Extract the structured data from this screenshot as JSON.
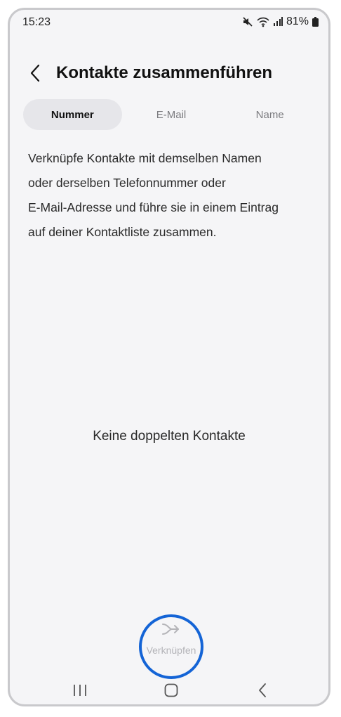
{
  "status_bar": {
    "time": "15:23",
    "battery": "81%",
    "icons": [
      "mute-icon",
      "wifi-icon",
      "signal-icon",
      "battery-icon"
    ]
  },
  "header": {
    "title": "Kontakte zusammenführen",
    "back_icon": "chevron-left-icon"
  },
  "tabs": [
    {
      "label": "Nummer",
      "selected": true
    },
    {
      "label": "E-Mail",
      "selected": false
    },
    {
      "label": "Name",
      "selected": false
    }
  ],
  "description": {
    "lines": [
      "Verknüpfe Kontakte mit demselben Namen",
      "oder derselben Telefonnummer oder",
      "E-Mail-Adresse und führe sie in einem Eintrag",
      "auf deiner Kontaktliste zusammen."
    ]
  },
  "empty_state": {
    "text": "Keine doppelten Kontakte"
  },
  "merge_action": {
    "label": "Verknüpfen",
    "icon": "merge-arrows-icon",
    "enabled": false
  },
  "nav_bar": {
    "icons": [
      "recent-apps-icon",
      "home-icon",
      "back-icon"
    ]
  },
  "colors": {
    "background": "#f5f5f7",
    "active_tab": "#e6e6ea",
    "highlight_ring": "#1464d6",
    "disabled_text": "#b4b4b8"
  }
}
